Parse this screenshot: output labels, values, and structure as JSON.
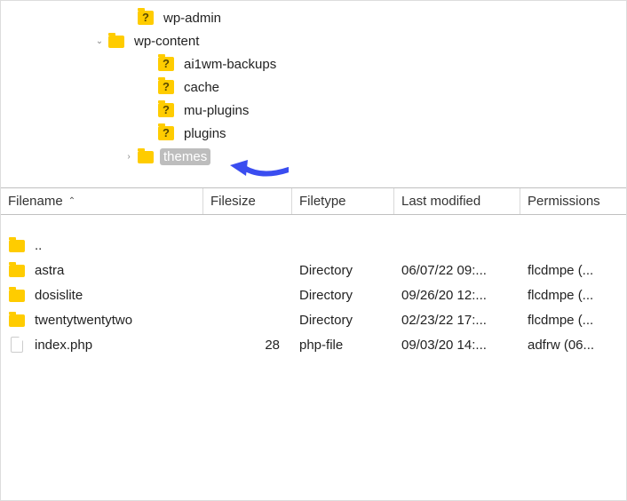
{
  "tree": {
    "items": [
      {
        "indent": 135,
        "chevron": "",
        "icon": "qfolder",
        "label": "wp-admin",
        "selected": false
      },
      {
        "indent": 102,
        "chevron": "down",
        "icon": "folder",
        "label": "wp-content",
        "selected": false
      },
      {
        "indent": 158,
        "chevron": "",
        "icon": "qfolder",
        "label": "ai1wm-backups",
        "selected": false
      },
      {
        "indent": 158,
        "chevron": "",
        "icon": "qfolder",
        "label": "cache",
        "selected": false
      },
      {
        "indent": 158,
        "chevron": "",
        "icon": "qfolder",
        "label": "mu-plugins",
        "selected": false
      },
      {
        "indent": 158,
        "chevron": "",
        "icon": "qfolder",
        "label": "plugins",
        "selected": false
      },
      {
        "indent": 135,
        "chevron": "right",
        "icon": "folder",
        "label": "themes",
        "selected": true
      }
    ]
  },
  "columns": {
    "name": "Filename",
    "size": "Filesize",
    "type": "Filetype",
    "mod": "Last modified",
    "perm": "Permissions"
  },
  "list": {
    "items": [
      {
        "icon": "folder",
        "name": "..",
        "size": "",
        "type": "",
        "mod": "",
        "perm": ""
      },
      {
        "icon": "folder",
        "name": "astra",
        "size": "",
        "type": "Directory",
        "mod": "06/07/22 09:...",
        "perm": "flcdmpe (..."
      },
      {
        "icon": "folder",
        "name": "dosislite",
        "size": "",
        "type": "Directory",
        "mod": "09/26/20 12:...",
        "perm": "flcdmpe (..."
      },
      {
        "icon": "folder",
        "name": "twentytwentytwo",
        "size": "",
        "type": "Directory",
        "mod": "02/23/22 17:...",
        "perm": "flcdmpe (..."
      },
      {
        "icon": "file",
        "name": "index.php",
        "size": "28",
        "type": "php-file",
        "mod": "09/03/20 14:...",
        "perm": "adfrw (06..."
      }
    ]
  },
  "glyphs": {
    "q": "?",
    "chev_down": "⌄",
    "chev_right": "›",
    "sort_up": "⌃"
  }
}
